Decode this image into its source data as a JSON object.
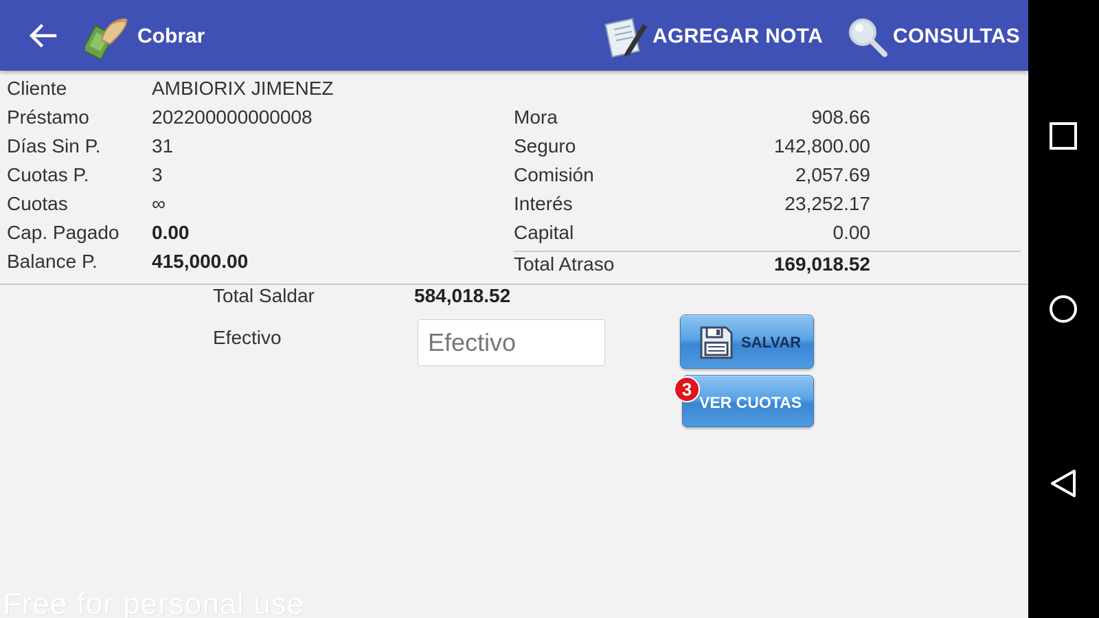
{
  "app_bar": {
    "title": "Cobrar",
    "back_icon": "arrow-left-icon",
    "title_icon": "money-hand-icon",
    "actions": [
      {
        "label": "AGREGAR NOTA",
        "icon": "note-pen-icon"
      },
      {
        "label": "CONSULTAS",
        "icon": "magnifier-icon"
      }
    ],
    "color": "#3f51b5"
  },
  "info_left": [
    {
      "label": "Cliente",
      "value": "AMBIORIX JIMENEZ"
    },
    {
      "label": "Préstamo",
      "value": "202200000000008"
    },
    {
      "label": "Días Sin P.",
      "value": "31"
    },
    {
      "label": "Cuotas P.",
      "value": "3"
    },
    {
      "label": "Cuotas",
      "value": "∞"
    },
    {
      "label": "Cap. Pagado",
      "value": "0.00"
    },
    {
      "label": "Balance P.",
      "value": "415,000.00"
    }
  ],
  "info_right": [
    {
      "label": "Mora",
      "value": "908.66"
    },
    {
      "label": "Seguro",
      "value": "142,800.00"
    },
    {
      "label": "Comisión",
      "value": "2,057.69"
    },
    {
      "label": "Interés",
      "value": "23,252.17"
    },
    {
      "label": "Capital",
      "value": "0.00"
    }
  ],
  "total_atraso": {
    "label": "Total Atraso",
    "value": "169,018.52"
  },
  "total_saldar": {
    "label": "Total Saldar",
    "value": "584,018.52"
  },
  "efectivo": {
    "label": "Efectivo",
    "placeholder": "Efectivo",
    "value": ""
  },
  "buttons": {
    "save_label": "SALVAR",
    "save_icon": "floppy-disk-icon",
    "cuotas_label": "VER CUOTAS",
    "cuotas_badge": "3"
  },
  "watermark": "Free for personal use",
  "system_nav": [
    "recents-square-icon",
    "home-circle-icon",
    "back-triangle-icon"
  ]
}
